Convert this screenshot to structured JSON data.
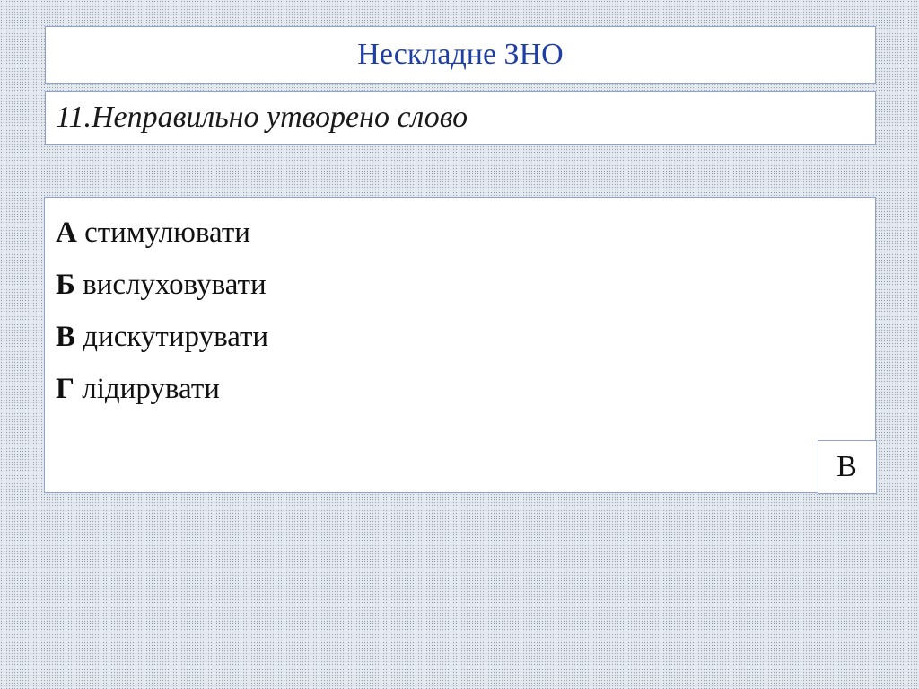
{
  "title": "Нескладне ЗНО",
  "question": {
    "number": "11.",
    "text": "Неправильно утворено слово"
  },
  "options": [
    {
      "letter": "А",
      "text": "стимулювати"
    },
    {
      "letter": "Б",
      "text": "вислуховувати"
    },
    {
      "letter": "В",
      "text": "дискутирувати"
    },
    {
      "letter": "Г",
      "text": "лідирувати"
    }
  ],
  "answer": "В",
  "colors": {
    "title_text": "#1f3fa8",
    "panel_border": "#8fa3c9",
    "background": "#e4e9f0"
  }
}
